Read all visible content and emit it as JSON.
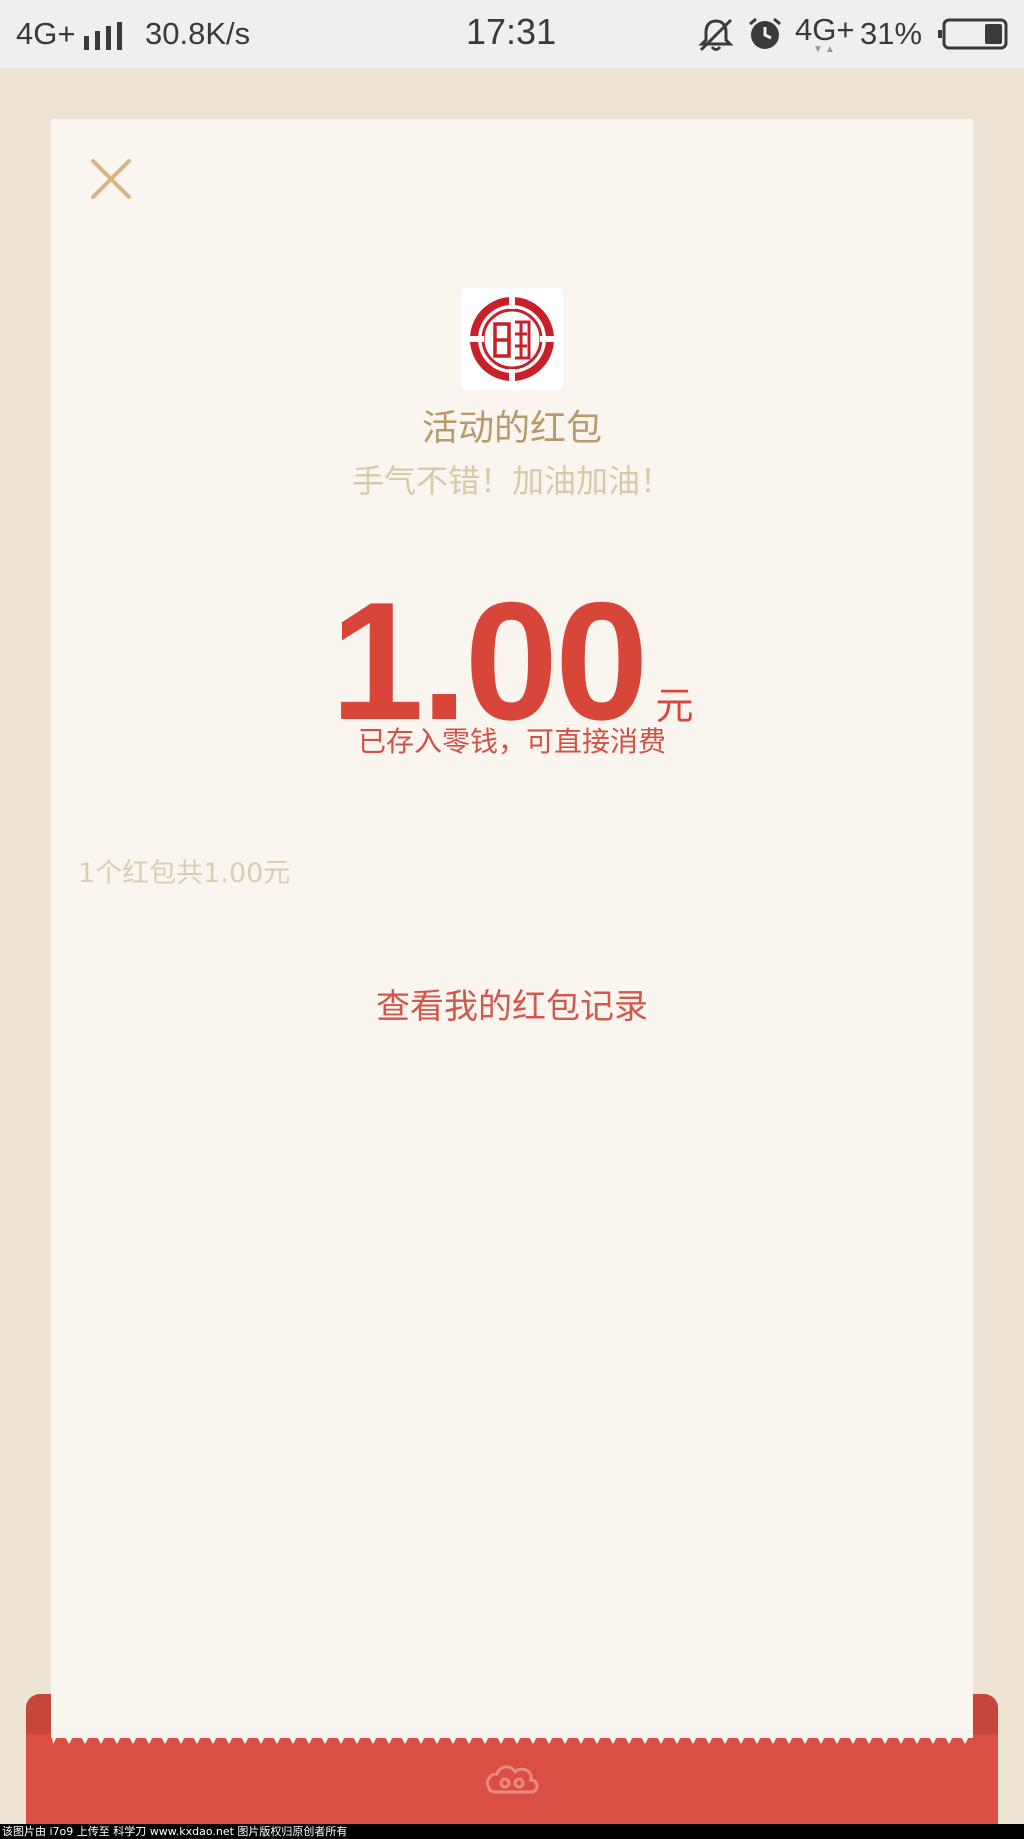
{
  "status_bar": {
    "network_left": "4G+",
    "speed": "30.8K/s",
    "time": "17:31",
    "network_right": "4G+",
    "battery_percent": "31%",
    "battery_level": 0.31,
    "icons": [
      "signal-icon",
      "bell-off-icon",
      "alarm-icon",
      "battery-icon"
    ]
  },
  "red_packet": {
    "close_icon": "close-icon",
    "sender_name": "活动的红包",
    "wish_text": "手气不错！加油加油！",
    "amount": "1.00",
    "currency": "元",
    "saved_note": "已存入零钱，可直接消费",
    "summary": "1个红包共1.00元",
    "records_link": "查看我的红包记录"
  },
  "watermark": "该图片由 i7o9 上传至 科学刀 www.kxdao.net 图片版权归原创者所有",
  "colors": {
    "background": "#ede4d3",
    "card": "#faf6ef",
    "accent_red": "#d8463a",
    "gold_text": "#b89a6b",
    "envelope_red": "#d94f43"
  }
}
